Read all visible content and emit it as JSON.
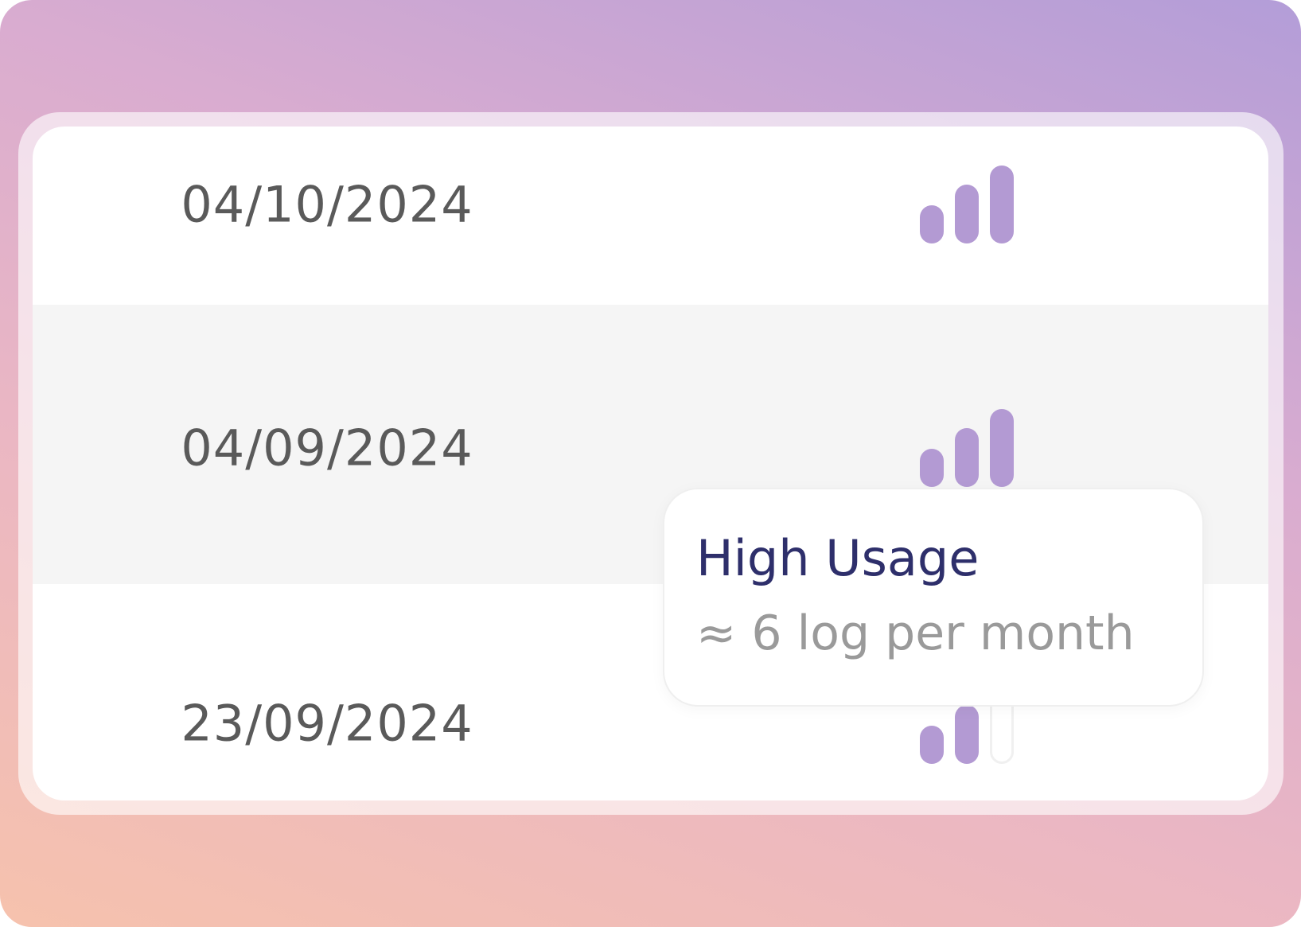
{
  "rows": [
    {
      "date": "04/10/2024",
      "usage_level": 3,
      "usage_max": 3
    },
    {
      "date": "04/09/2024",
      "usage_level": 3,
      "usage_max": 3
    },
    {
      "date": "23/09/2024",
      "usage_level": 2,
      "usage_max": 3
    }
  ],
  "tooltip": {
    "title": "High Usage",
    "subtitle": "≈ 6 log per month"
  },
  "colors": {
    "bar_filled": "#b39ad3",
    "tooltip_title": "#2e2f6b",
    "tooltip_subtitle": "#9a9a9a",
    "date_text": "#5a5a5a",
    "alt_row": "#f5f5f5"
  },
  "icons": {
    "usage": "signal-strength-icon"
  }
}
